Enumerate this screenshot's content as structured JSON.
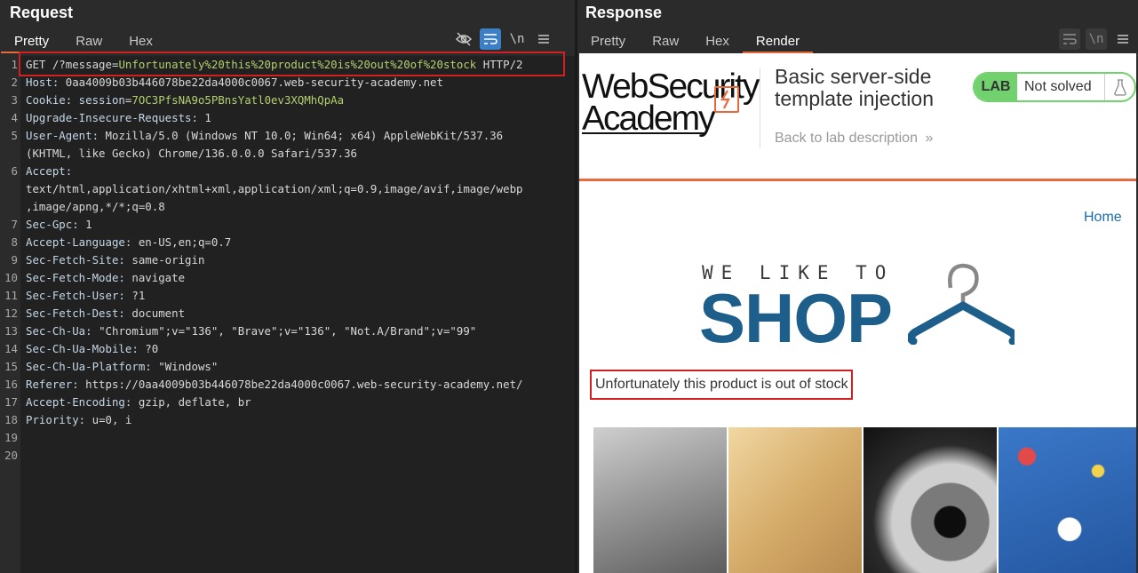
{
  "request": {
    "title": "Request",
    "tabs": [
      "Pretty",
      "Raw",
      "Hex"
    ],
    "active_tab": "Pretty",
    "toolbar": {
      "hide_icon": "eye-slash-icon",
      "wrap_icon": "wrap-icon",
      "newline_label": "\\n",
      "menu_icon": "menu-icon"
    },
    "lines": [
      {
        "n": "1",
        "parts": [
          {
            "t": "GET /?message=",
            "c": "v"
          },
          {
            "t": "Unfortunately%20this%20product%20is%20out%20of%20stock",
            "c": "g"
          },
          {
            "t": " HTTP/2",
            "c": "v"
          }
        ]
      },
      {
        "n": "2",
        "parts": [
          {
            "t": "Host: ",
            "c": "k"
          },
          {
            "t": "0aa4009b03b446078be22da4000c0067.web-security-academy.net",
            "c": "v"
          }
        ]
      },
      {
        "n": "3",
        "parts": [
          {
            "t": "Cookie: session",
            "c": "k"
          },
          {
            "t": "=",
            "c": "v"
          },
          {
            "t": "7OC3PfsNA9o5PBnsYatl0ev3XQMhQpAa",
            "c": "g"
          }
        ]
      },
      {
        "n": "4",
        "parts": [
          {
            "t": "Upgrade-Insecure-Requests: ",
            "c": "k"
          },
          {
            "t": "1",
            "c": "v"
          }
        ]
      },
      {
        "n": "5",
        "parts": [
          {
            "t": "User-Agent: ",
            "c": "k"
          },
          {
            "t": "Mozilla/5.0 (Windows NT 10.0; Win64; x64) AppleWebKit/537.36",
            "c": "v"
          }
        ]
      },
      {
        "n": "",
        "parts": [
          {
            "t": "(KHTML, like Gecko) Chrome/136.0.0.0 Safari/537.36",
            "c": "v"
          }
        ]
      },
      {
        "n": "6",
        "parts": [
          {
            "t": "Accept:",
            "c": "k"
          }
        ]
      },
      {
        "n": "",
        "parts": [
          {
            "t": "text/html,application/xhtml+xml,application/xml;q=0.9,image/avif,image/webp",
            "c": "v"
          }
        ]
      },
      {
        "n": "",
        "parts": [
          {
            "t": ",image/apng,*/*;q=0.8",
            "c": "v"
          }
        ]
      },
      {
        "n": "7",
        "parts": [
          {
            "t": "Sec-Gpc: ",
            "c": "k"
          },
          {
            "t": "1",
            "c": "v"
          }
        ]
      },
      {
        "n": "8",
        "parts": [
          {
            "t": "Accept-Language: ",
            "c": "k"
          },
          {
            "t": "en-US,en;q=0.7",
            "c": "v"
          }
        ]
      },
      {
        "n": "9",
        "parts": [
          {
            "t": "Sec-Fetch-Site: ",
            "c": "k"
          },
          {
            "t": "same-origin",
            "c": "v"
          }
        ]
      },
      {
        "n": "10",
        "parts": [
          {
            "t": "Sec-Fetch-Mode: ",
            "c": "k"
          },
          {
            "t": "navigate",
            "c": "v"
          }
        ]
      },
      {
        "n": "11",
        "parts": [
          {
            "t": "Sec-Fetch-User: ",
            "c": "k"
          },
          {
            "t": "?1",
            "c": "v"
          }
        ]
      },
      {
        "n": "12",
        "parts": [
          {
            "t": "Sec-Fetch-Dest: ",
            "c": "k"
          },
          {
            "t": "document",
            "c": "v"
          }
        ]
      },
      {
        "n": "13",
        "parts": [
          {
            "t": "Sec-Ch-Ua: ",
            "c": "k"
          },
          {
            "t": "\"Chromium\";v=\"136\", \"Brave\";v=\"136\", \"Not.A/Brand\";v=\"99\"",
            "c": "v"
          }
        ]
      },
      {
        "n": "14",
        "parts": [
          {
            "t": "Sec-Ch-Ua-Mobile: ",
            "c": "k"
          },
          {
            "t": "?0",
            "c": "v"
          }
        ]
      },
      {
        "n": "15",
        "parts": [
          {
            "t": "Sec-Ch-Ua-Platform: ",
            "c": "k"
          },
          {
            "t": "\"Windows\"",
            "c": "v"
          }
        ]
      },
      {
        "n": "16",
        "parts": [
          {
            "t": "Referer: ",
            "c": "k"
          },
          {
            "t": "https://0aa4009b03b446078be22da4000c0067.web-security-academy.net/",
            "c": "v"
          }
        ]
      },
      {
        "n": "17",
        "parts": [
          {
            "t": "Accept-Encoding: ",
            "c": "k"
          },
          {
            "t": "gzip, deflate, br",
            "c": "v"
          }
        ]
      },
      {
        "n": "18",
        "parts": [
          {
            "t": "Priority: ",
            "c": "k"
          },
          {
            "t": "u=0, i",
            "c": "v"
          }
        ]
      },
      {
        "n": "19",
        "parts": []
      },
      {
        "n": "20",
        "parts": []
      }
    ]
  },
  "response": {
    "title": "Response",
    "tabs": [
      "Pretty",
      "Raw",
      "Hex",
      "Render"
    ],
    "active_tab": "Render",
    "toolbar": {
      "wrap_icon": "wrap-icon",
      "newline_label": "\\n",
      "menu_icon": "menu-icon"
    },
    "page": {
      "logo_line1": "WebSecurity",
      "logo_line2": "Academy",
      "lab_title": "Basic server-side template injection",
      "back_link": "Back to lab description",
      "back_chevron": "»",
      "lab_badge": "LAB",
      "lab_status": "Not solved",
      "flask_icon": "flask-icon",
      "home_link": "Home",
      "shop_tagline": "WE LIKE TO",
      "shop_name": "SHOP",
      "message": "Unfortunately this product is out of stock",
      "products": [
        "product-image-1",
        "product-image-2",
        "product-image-3",
        "product-image-4"
      ]
    }
  },
  "colors": {
    "accent": "#e8693c",
    "highlight_box": "#d21f1f",
    "string_green": "#b4cf6f",
    "lab_green": "#70d16d",
    "link_blue": "#1a6cb0",
    "shop_blue": "#1d5e8a"
  }
}
